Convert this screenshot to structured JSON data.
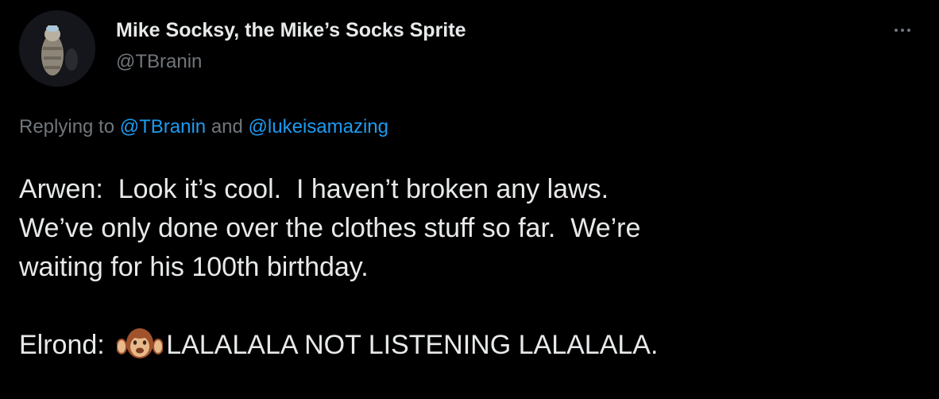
{
  "author": {
    "display_name": "Mike Socksy, the Mike’s Socks Sprite",
    "handle": "@TBranin",
    "avatar_icon": "profile-photo-icon"
  },
  "more_icon": "ellipsis-icon",
  "reply_context": {
    "prefix": "Replying to ",
    "mention_1": "@TBranin",
    "connector": " and ",
    "mention_2": "@lukeisamazing"
  },
  "tweet": {
    "line_1": "Arwen:  Look it’s cool.  I haven’t broken any laws.",
    "line_2": "We’ve only done over the clothes stuff so far.  We’re",
    "line_3": "waiting for his 100th birthday.",
    "elrond_label": "Elrond: ",
    "emoji_icon": "hear-no-evil-monkey-icon",
    "elrond_text": "LALALALA NOT LISTENING LALALALA."
  },
  "colors": {
    "background": "#000000",
    "primary_text": "#e7e9ea",
    "secondary_text": "#71767b",
    "link": "#1d9bf0"
  }
}
